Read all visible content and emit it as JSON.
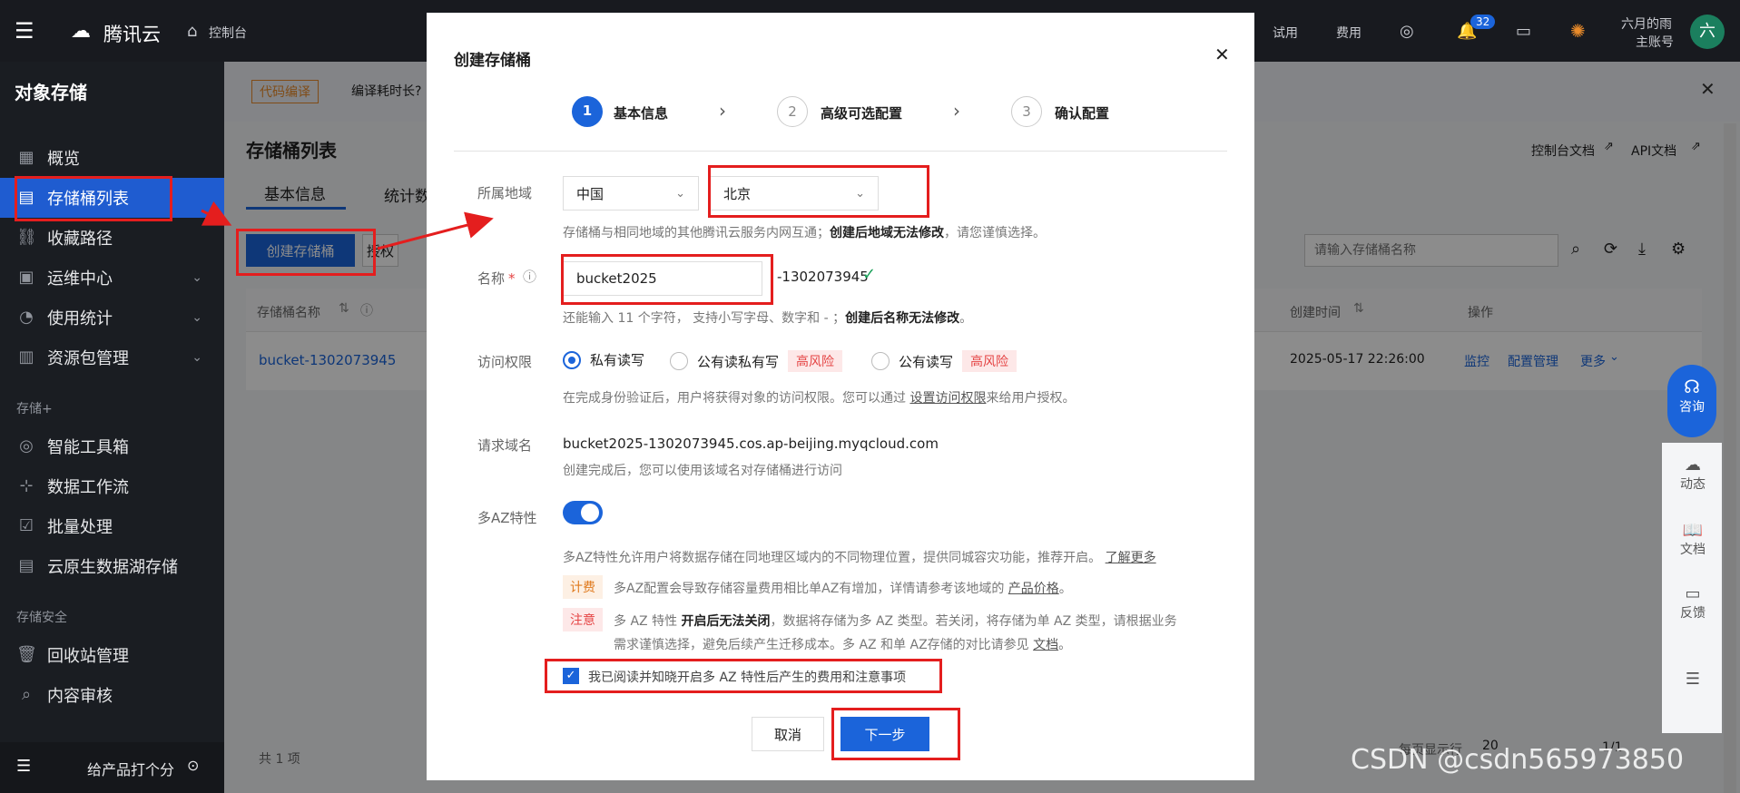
{
  "topbar": {
    "brand": "腾讯云",
    "console": "控制台",
    "trial": "试用",
    "fee": "费用",
    "notifications": "32",
    "user_name": "六月的雨",
    "user_role": "主账号",
    "avatar": "六"
  },
  "sidebar": {
    "title": "对象存储",
    "items": [
      {
        "label": "概览",
        "icon": "dashboard-icon"
      },
      {
        "label": "存储桶列表",
        "icon": "bucket-icon"
      },
      {
        "label": "收藏路径",
        "icon": "link-icon"
      },
      {
        "label": "运维中心",
        "icon": "calendar-icon"
      },
      {
        "label": "使用统计",
        "icon": "pie-icon"
      },
      {
        "label": "资源包管理",
        "icon": "package-icon"
      }
    ],
    "group_storage_plus": "存储+",
    "items2": [
      {
        "label": "智能工具箱"
      },
      {
        "label": "数据工作流"
      },
      {
        "label": "批量处理"
      },
      {
        "label": "云原生数据湖存储"
      }
    ],
    "group_security": "存储安全",
    "items3": [
      {
        "label": "回收站管理"
      },
      {
        "label": "内容审核"
      }
    ],
    "feedback": "给产品打个分"
  },
  "main": {
    "banner_tag": "代码编译",
    "banner_text": "编译耗时长?",
    "page_title": "存储桶列表",
    "tabs": [
      "基本信息",
      "统计数"
    ],
    "create_button": "创建存储桶",
    "auth_button": "授权",
    "doc_link": "控制台文档",
    "api_link": "API文档",
    "search_placeholder": "请输入存储桶名称",
    "col_name": "存储桶名称",
    "col_created": "创建时间",
    "col_actions": "操作",
    "row_name": "bucket-1302073945",
    "row_created": "2025-05-17 22:26:00",
    "row_actions": [
      "监控",
      "配置管理",
      "更多"
    ],
    "total": "共 1 项",
    "per_page_label": "每页显示行",
    "per_page_value": "20",
    "pager": "1/1",
    "float": {
      "consult": "咨询",
      "items": [
        "动态",
        "文档",
        "反馈"
      ]
    },
    "watermark": "CSDN @csdn565973850"
  },
  "dialog": {
    "title": "创建存储桶",
    "steps": [
      {
        "num": "1",
        "label": "基本信息"
      },
      {
        "num": "2",
        "label": "高级可选配置"
      },
      {
        "num": "3",
        "label": "确认配置"
      }
    ],
    "region": {
      "label": "所属地域",
      "country": "中国",
      "city": "北京",
      "hint_prefix": "存储桶与相同地域的其他腾讯云服务内网互通；",
      "hint_bold": "创建后地域无法修改",
      "hint_suffix": "，请您谨慎选择。"
    },
    "name": {
      "label": "名称",
      "required": "*",
      "value": "bucket2025",
      "suffix": "-1302073945",
      "hint_prefix": "还能输入 11 个字符， 支持小写字母、数字和 - ；",
      "hint_bold": "创建后名称无法修改",
      "hint_suffix": "。"
    },
    "access": {
      "label": "访问权限",
      "options": [
        {
          "label": "私有读写",
          "selected": true,
          "risk": ""
        },
        {
          "label": "公有读私有写",
          "selected": false,
          "risk": "高风险"
        },
        {
          "label": "公有读写",
          "selected": false,
          "risk": "高风险"
        }
      ],
      "hint_prefix": "在完成身份验证后，用户将获得对象的访问权限。您可以通过",
      "hint_link": "设置访问权限",
      "hint_suffix": "来给用户授权。"
    },
    "domain": {
      "label": "请求域名",
      "value": "bucket2025-1302073945.cos.ap-beijing.myqcloud.com",
      "hint": "创建完成后，您可以使用该域名对存储桶进行访问"
    },
    "multi_az": {
      "label": "多AZ特性",
      "enabled": true,
      "desc": "多AZ特性允许用户将数据存储在同地理区域内的不同物理位置，提供同城容灾功能，推荐开启。",
      "desc_link": "了解更多",
      "fee_tag": "计费",
      "fee_text": "多AZ配置会导致存储容量费用相比单AZ有增加，详情请参考该地域的",
      "fee_link": "产品价格",
      "fee_end": "。",
      "note_tag": "注意",
      "note_prefix": "多 AZ 特性",
      "note_bold": "开启后无法关闭",
      "note_mid": "，数据将存储为多 AZ 类型。若关闭，将存储为单 AZ 类型，请根据业务",
      "note_line2": "需求谨慎选择，避免后续产生迁移成本。多 AZ 和单 AZ存储的对比请参见",
      "note_link": "文档",
      "note_end": "。",
      "agree": "我已阅读并知晓开启多 AZ 特性后产生的费用和注意事项",
      "agree_checked": true
    },
    "cancel": "取消",
    "next": "下一步"
  },
  "colors": {
    "primary": "#1b64da",
    "danger": "#e54545",
    "annotation": "#e41e1e"
  }
}
